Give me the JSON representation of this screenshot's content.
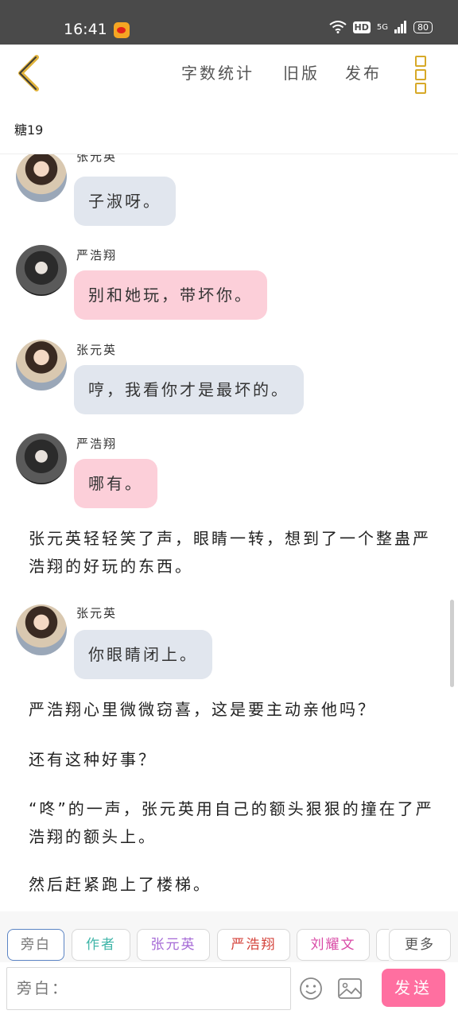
{
  "status_bar": {
    "time": "16:41",
    "hd": "HD",
    "signal": "5G",
    "battery": "80"
  },
  "topnav": {
    "word_count": "字数统计",
    "old_version": "旧版",
    "publish": "发布"
  },
  "chapter": {
    "title": "糖19"
  },
  "messages": [
    {
      "sender": "张元英",
      "text": "子淑呀。",
      "style": "blue"
    },
    {
      "sender": "严浩翔",
      "text": "别和她玩，带坏你。",
      "style": "pink"
    },
    {
      "sender": "张元英",
      "text": "哼，我看你才是最坏的。",
      "style": "blue"
    },
    {
      "sender": "严浩翔",
      "text": "哪有。",
      "style": "pink"
    },
    {
      "sender": "张元英",
      "text": "你眼睛闭上。",
      "style": "blue"
    }
  ],
  "narrations": [
    "张元英轻轻笑了声，眼睛一转，想到了一个整蛊严浩翔的好玩的东西。",
    "严浩翔心里微微窃喜，这是要主动亲他吗？",
    "还有这种好事？",
    "“咚”的一声，张元英用自己的额头狠狠的撞在了严浩翔的额头上。",
    "然后赶紧跑上了楼梯。"
  ],
  "roles": {
    "narration": "旁白",
    "author": "作者",
    "zhang": "张元英",
    "yan": "严浩翔",
    "liu": "刘耀文",
    "more": "更多"
  },
  "input": {
    "placeholder": "旁白："
  },
  "send_label": "发送",
  "colors": {
    "accent_pink": "#ff6fa0",
    "bubble_blue": "#e1e6ee",
    "bubble_pink": "#fccfd9",
    "menu_gold": "#d7a928"
  },
  "icons": {
    "back": "chevron-left-icon",
    "more": "vertical-dots-icon",
    "emoji": "emoji-icon",
    "image": "image-icon"
  }
}
